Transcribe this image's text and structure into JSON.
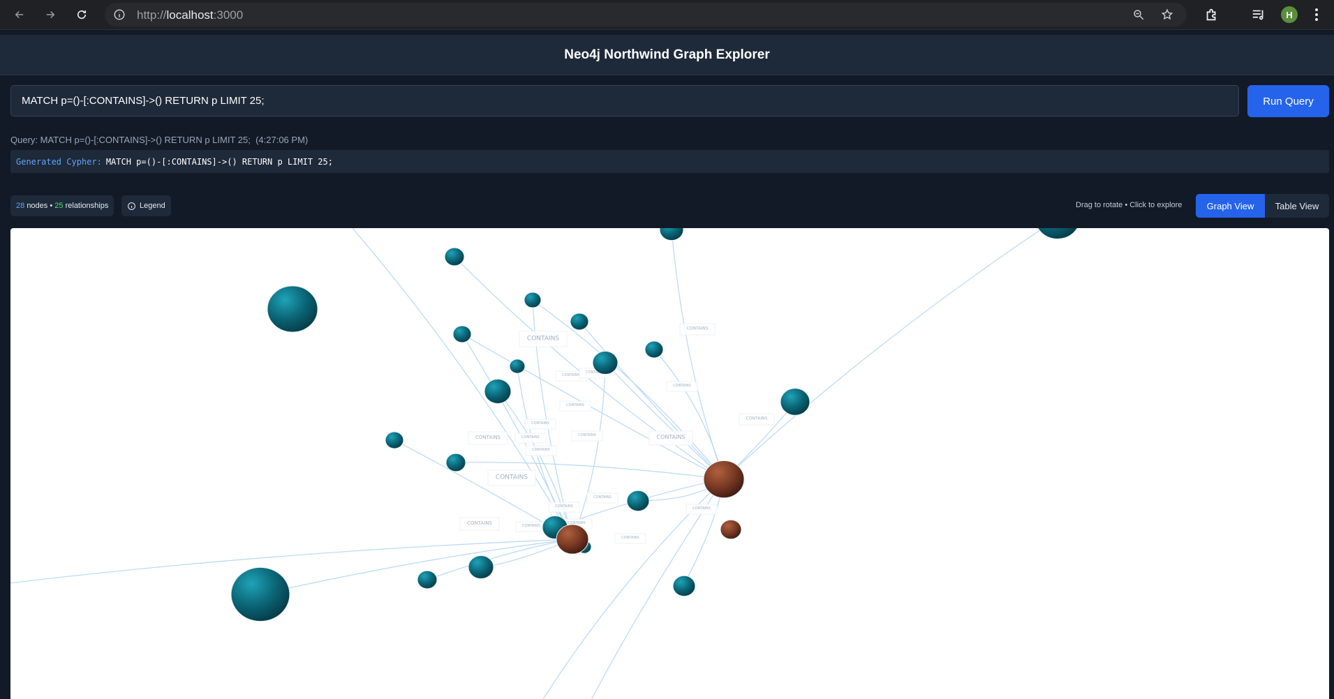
{
  "browser": {
    "url_scheme": "http://",
    "url_host": "localhost",
    "url_port": ":3000",
    "profile_initial": "H"
  },
  "app": {
    "title": "Neo4j Northwind Graph Explorer"
  },
  "query": {
    "value": "MATCH p=()-[:CONTAINS]->() RETURN p LIMIT 25;",
    "run_label": "Run Query",
    "meta_prefix": "Query:",
    "meta_query": "MATCH p=()-[:CONTAINS]->() RETURN p LIMIT 25;",
    "meta_time": "(4:27:06 PM)",
    "generated_label": "Generated Cypher:",
    "generated_value": "MATCH p=()-[:CONTAINS]->() RETURN p LIMIT 25;"
  },
  "toolbar": {
    "nodes_count": "28",
    "nodes_text": "nodes",
    "separator": "•",
    "rels_count": "25",
    "rels_text": "relationships",
    "legend_label": "Legend",
    "hint": "Drag to rotate • Click to explore",
    "graph_view_label": "Graph View",
    "table_view_label": "Table View"
  },
  "graph": {
    "relationship_label": "CONTAINS",
    "colors": {
      "product_node": "#0e6a7c",
      "order_node": "#7a3a24",
      "edge": "#b8d8f4",
      "background": "#ffffff"
    }
  }
}
